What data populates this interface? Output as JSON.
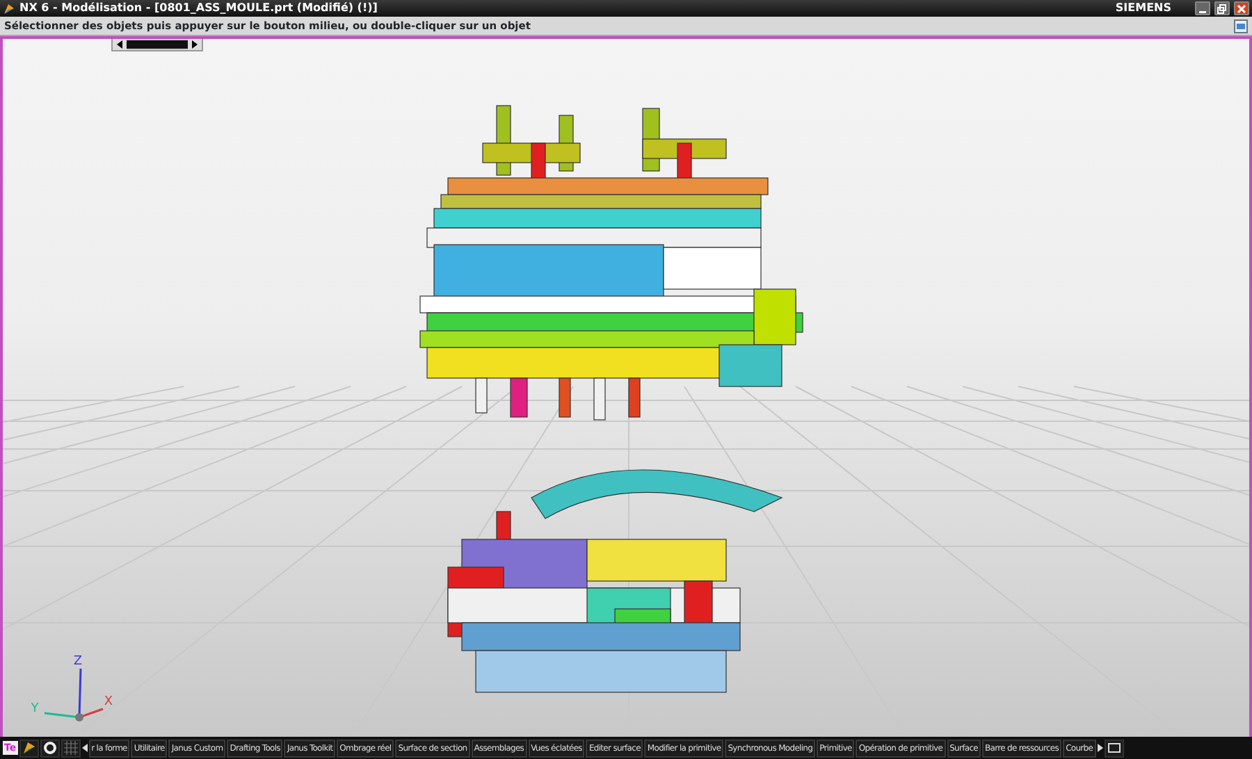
{
  "window": {
    "title": "NX 6 - Modélisation - [0801_ASS_MOULE.prt (Modifié)    (!)]",
    "brand": "SIEMENS"
  },
  "prompt": "Sélectionner des objets puis appuyer sur le bouton milieu, ou double-cliquer sur un objet",
  "triad": {
    "axes": [
      {
        "label": "Z",
        "color": "#3a3ad0"
      },
      {
        "label": "Y",
        "color": "#20b890"
      },
      {
        "label": "X",
        "color": "#d04040"
      }
    ]
  },
  "corner_label": "Te",
  "toolbar_tabs": [
    "r la forme",
    "Utilitaire",
    "Janus Custom",
    "Drafting Tools",
    "Janus Toolkit",
    "Ombrage réel",
    "Surface de section",
    "Assemblages",
    "Vues éclatées",
    "Editer surface",
    "Modifier la primitive",
    "Synchronous Modeling",
    "Primitive",
    "Opération de primitive",
    "Surface",
    "Barre de ressources",
    "Courbe"
  ]
}
